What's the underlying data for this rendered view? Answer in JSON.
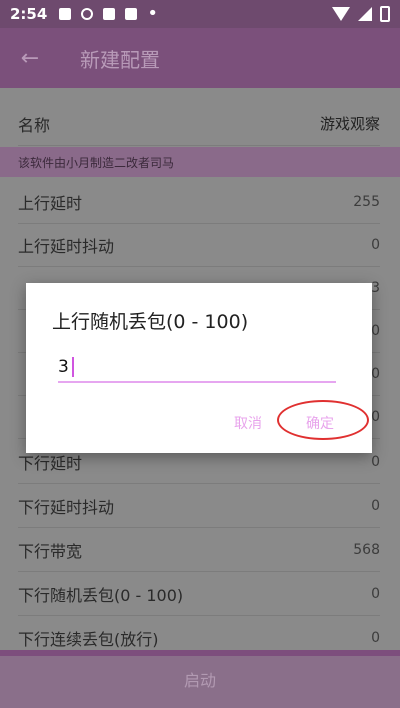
{
  "status_bar": {
    "time": "2:54",
    "icons": [
      "image-icon",
      "record-icon",
      "play-icon",
      "font-icon"
    ],
    "dot": "•"
  },
  "app_bar": {
    "back_icon": "←",
    "title": "新建配置"
  },
  "name_row": {
    "label": "名称",
    "value": "游戏观察"
  },
  "banner": "该软件由小月制造二改者司马",
  "rows": [
    {
      "label": "上行延时",
      "value": "255"
    },
    {
      "label": "上行延时抖动",
      "value": "0"
    },
    {
      "label": "下行延时",
      "value": "0"
    },
    {
      "label": "下行延时抖动",
      "value": "0"
    },
    {
      "label": "下行带宽",
      "value": "568"
    },
    {
      "label": "下行随机丢包(0 - 100)",
      "value": "0"
    },
    {
      "label": "下行连续丢包(放行)",
      "value": "0"
    }
  ],
  "hidden_row_values": [
    "3",
    "0",
    "0",
    "0"
  ],
  "dialog": {
    "title": "上行随机丢包(0 - 100)",
    "input_value": "3",
    "cancel_label": "取消",
    "ok_label": "确定"
  },
  "bottom_button": "启动",
  "colors": {
    "accent": "#7b507b",
    "dialog_button": "#e8a4ec",
    "annotation_red": "#e03030"
  }
}
